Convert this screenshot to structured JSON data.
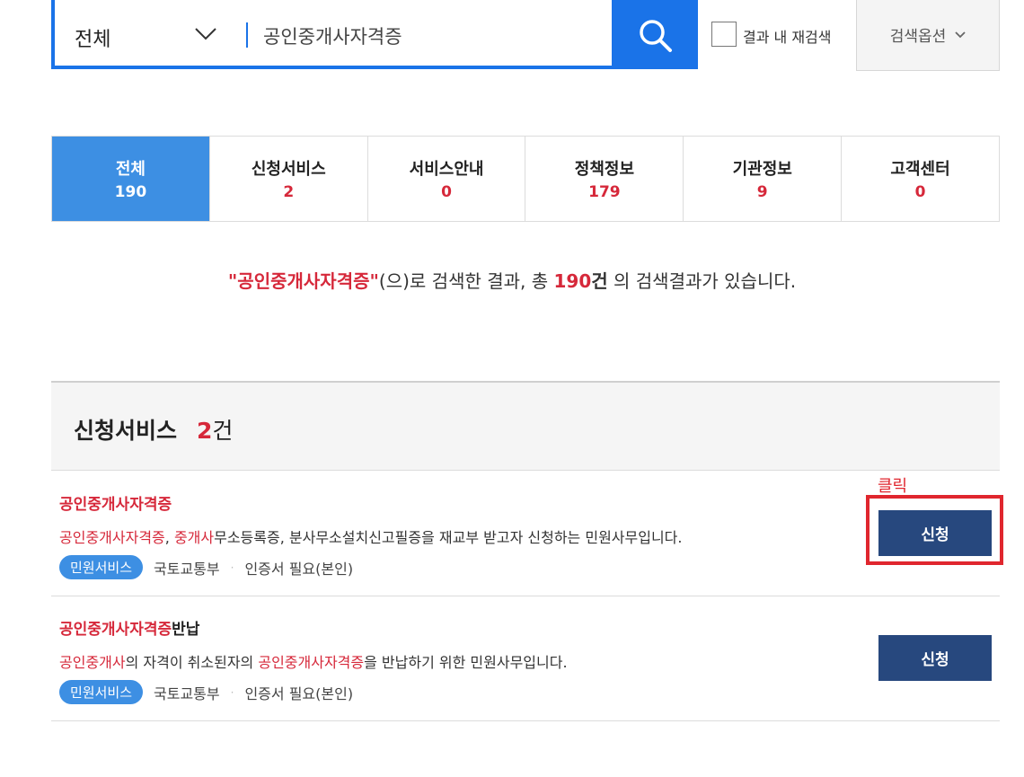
{
  "search": {
    "category": "전체",
    "query": "공인중개사자격증",
    "refine_label": "결과 내 재검색",
    "options_label": "검색옵션"
  },
  "tabs": [
    {
      "label": "전체",
      "count": "190",
      "active": true
    },
    {
      "label": "신청서비스",
      "count": "2",
      "active": false
    },
    {
      "label": "서비스안내",
      "count": "0",
      "active": false
    },
    {
      "label": "정책정보",
      "count": "179",
      "active": false
    },
    {
      "label": "기관정보",
      "count": "9",
      "active": false
    },
    {
      "label": "고객센터",
      "count": "0",
      "active": false
    }
  ],
  "summary": {
    "keyword": "\"공인중개사자격증\"",
    "middle": "(으)로 검색한 결과, 총 ",
    "total": "190",
    "unit": "건",
    "suffix": " 의 검색결과가 있습니다."
  },
  "section": {
    "title": "신청서비스",
    "count": "2",
    "unit": "건"
  },
  "results": [
    {
      "title_hl": "공인중개사자격증",
      "title_rest": "",
      "desc": [
        {
          "t": "공인중개사자격증",
          "hl": true
        },
        {
          "t": ", ",
          "hl": false
        },
        {
          "t": "중개사",
          "hl": true
        },
        {
          "t": "무소등록증, 분사무소설치신고필증을 재교부 받고자 신청하는 민원사무입니다.",
          "hl": false
        }
      ],
      "badge": "민원서비스",
      "agency": "국토교통부",
      "auth": "인증서 필요(본인)",
      "button": "신청"
    },
    {
      "title_hl": "공인중개사자격증",
      "title_rest": "반납",
      "desc": [
        {
          "t": "공인중개사",
          "hl": true
        },
        {
          "t": "의 자격이 취소된자의 ",
          "hl": false
        },
        {
          "t": "공인중개사자격증",
          "hl": true
        },
        {
          "t": "을 반납하기 위한 민원사무입니다.",
          "hl": false
        }
      ],
      "badge": "민원서비스",
      "agency": "국토교통부",
      "auth": "인증서 필요(본인)",
      "button": "신청"
    }
  ],
  "annotation": {
    "label": "클릭",
    "color": "#e0262e"
  },
  "colors": {
    "primary_blue": "#1a73e8",
    "tab_active": "#3d8fe3",
    "highlight_red": "#d6283a",
    "apply_button": "#27487e"
  }
}
